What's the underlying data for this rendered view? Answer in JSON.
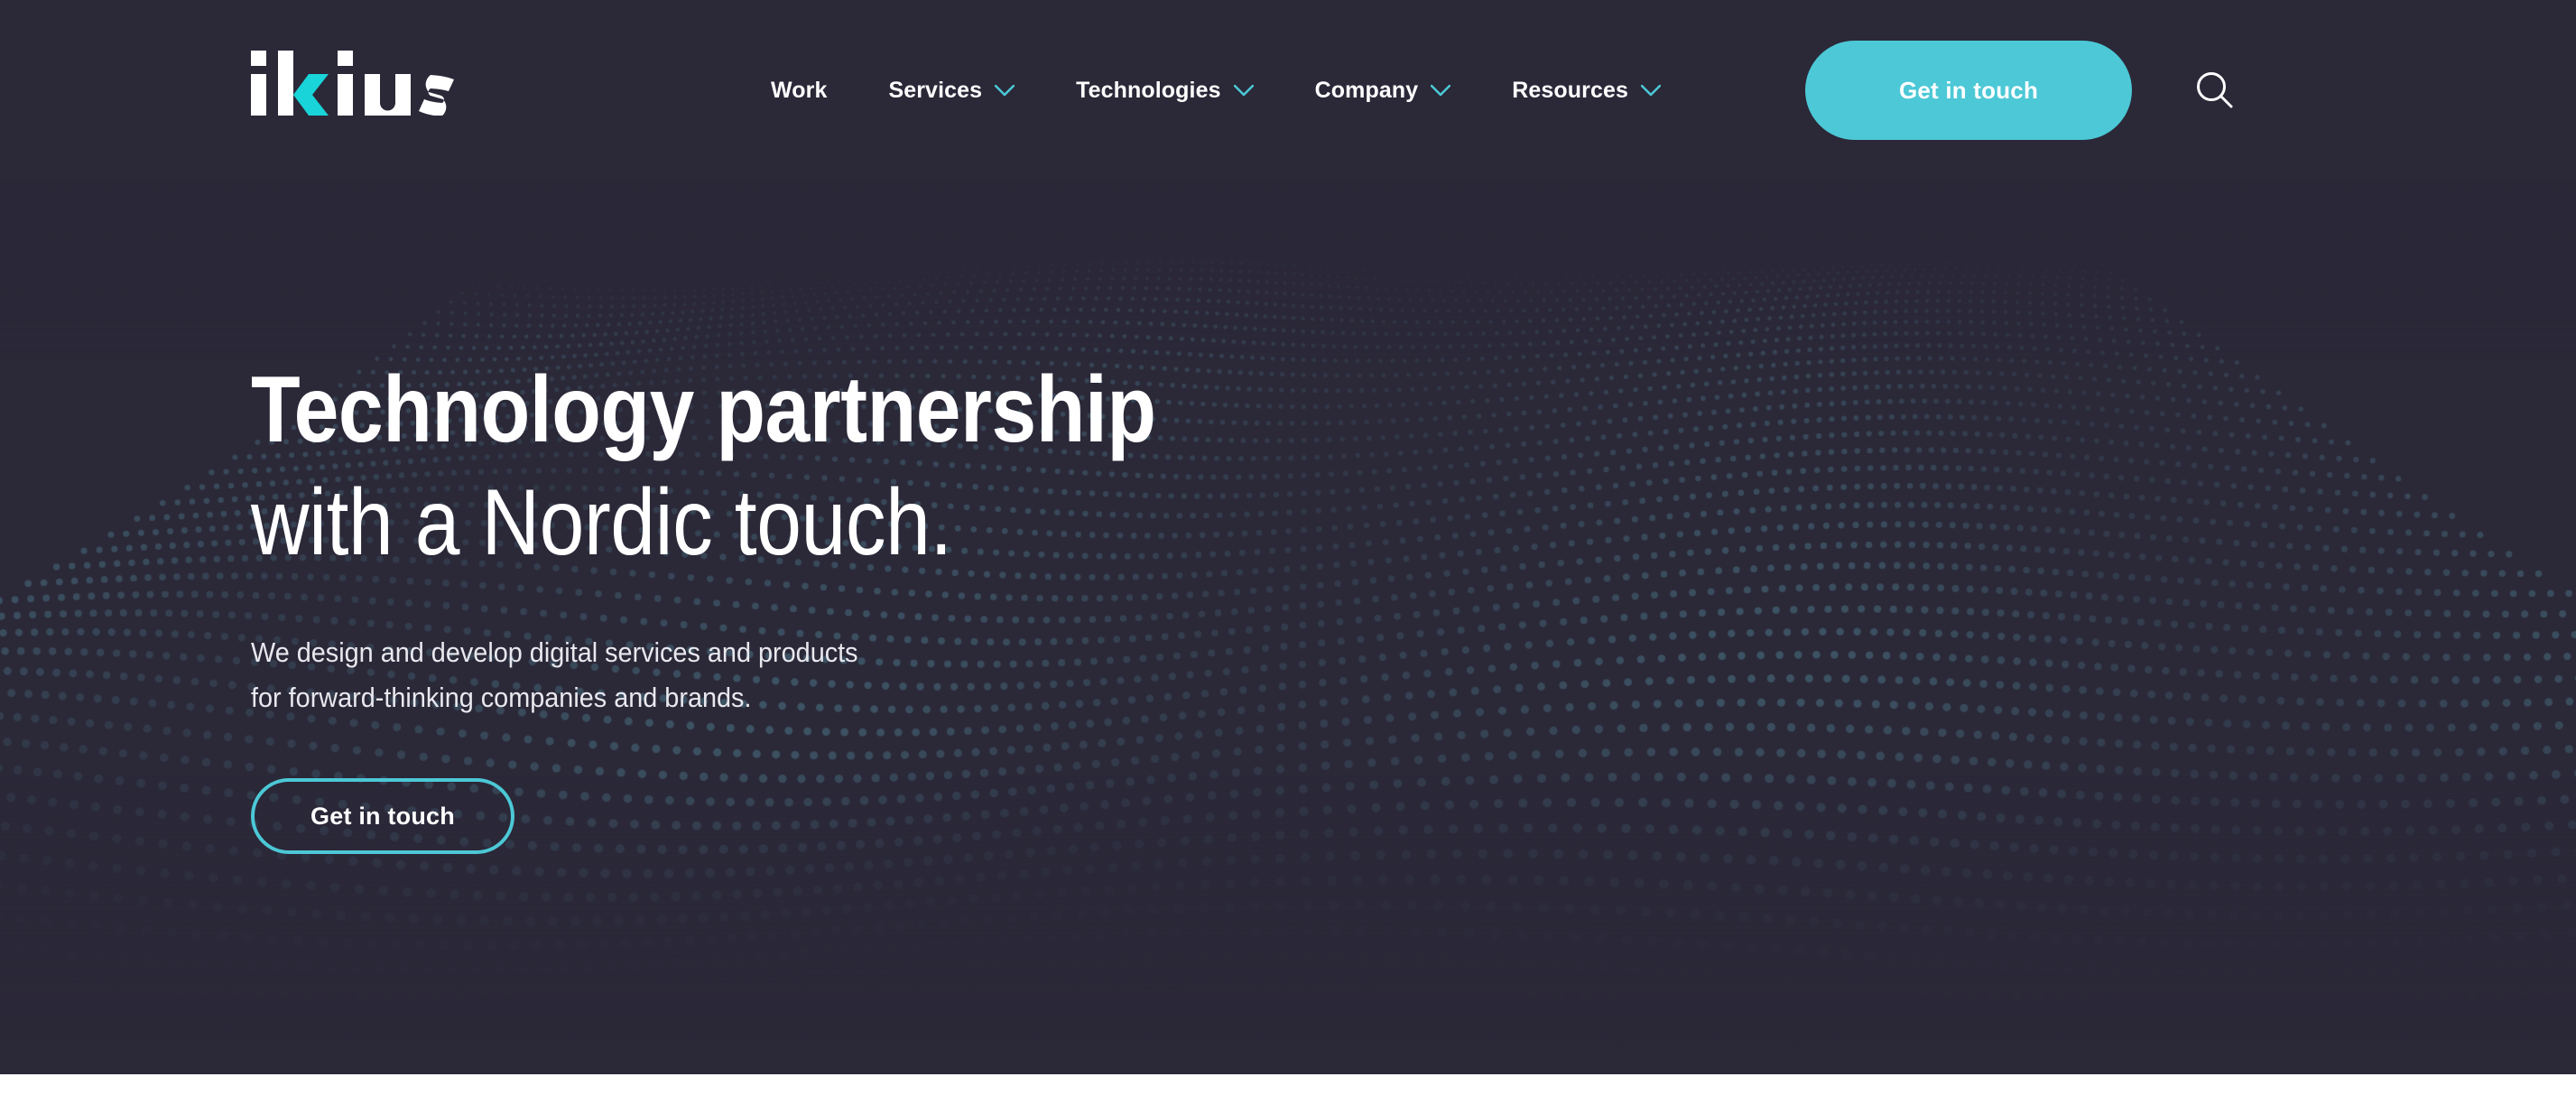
{
  "site": {
    "background_dark": "#2b2838",
    "accent": "#4cc8d6",
    "text_light": "#ffffff",
    "wave_dot_color": "#3d5a66"
  },
  "header": {
    "logo": {
      "text": "ikius",
      "accent_letter": "k",
      "accent_color": "#19d4d9",
      "name": "ikius-logo"
    },
    "nav": [
      {
        "label": "Work",
        "has_dropdown": false
      },
      {
        "label": "Services",
        "has_dropdown": true
      },
      {
        "label": "Technologies",
        "has_dropdown": true
      },
      {
        "label": "Company",
        "has_dropdown": true
      },
      {
        "label": "Resources",
        "has_dropdown": true
      }
    ],
    "cta": {
      "label": "Get in touch"
    },
    "search": {
      "icon": "search-icon",
      "label": "Search"
    }
  },
  "hero": {
    "title_line_1": "Technology partnership",
    "title_line_2": "with a Nordic touch.",
    "subtitle_line_1": "We design and develop digital services and products",
    "subtitle_line_2": "for forward-thinking companies and brands.",
    "cta": {
      "label": "Get in touch"
    }
  }
}
